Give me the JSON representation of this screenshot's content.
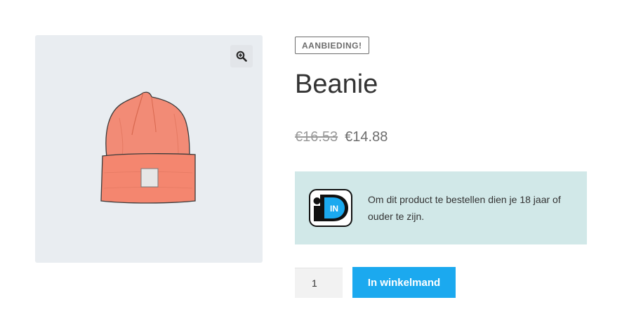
{
  "product": {
    "sale_badge": "AANBIEDING!",
    "title": "Beanie",
    "old_price": "€16.53",
    "new_price": "€14.88",
    "image_alt": "Beanie",
    "image_color": "#f28b76"
  },
  "age_notice": {
    "logo_text": "IN",
    "logo_initial": "i",
    "text": "Om dit product te bestellen dien je 18 jaar of ouder te zijn.",
    "background": "#d1e8e8",
    "logo_accent": "#1ba9ef"
  },
  "cart": {
    "quantity": "1",
    "button_label": "In winkelmand",
    "button_color": "#1ba9ef"
  },
  "icons": {
    "zoom": "zoom-in-icon",
    "logo": "idin-logo-icon"
  }
}
